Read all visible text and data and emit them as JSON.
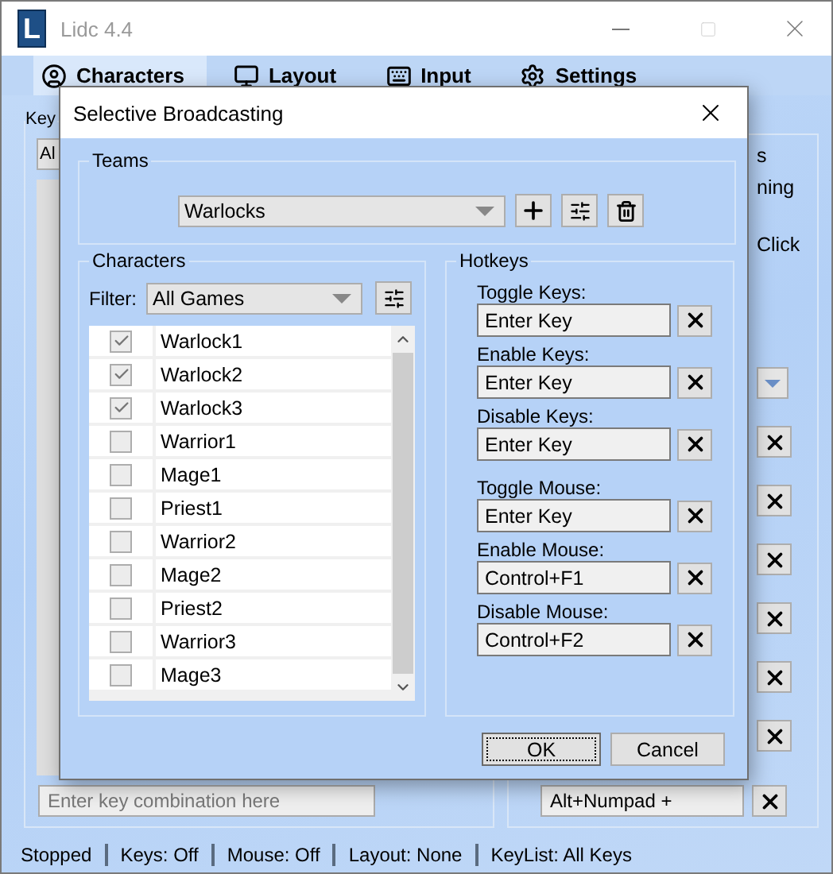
{
  "window": {
    "logo": "L",
    "title": "Lidc 4.4"
  },
  "tabs": [
    {
      "label": "Characters",
      "selected": true
    },
    {
      "label": "Layout",
      "selected": false
    },
    {
      "label": "Input",
      "selected": false
    },
    {
      "label": "Settings",
      "selected": false
    }
  ],
  "background": {
    "left_group_label": "Key",
    "left_dropdown": "Al",
    "right_texts": [
      "s",
      "ning",
      "Click"
    ],
    "key_field": {
      "placeholder": "Enter key combination here"
    },
    "right_field": {
      "value": "Alt+Numpad +"
    }
  },
  "dialog": {
    "title": "Selective Broadcasting",
    "teams": {
      "label": "Teams",
      "value": "Warlocks"
    },
    "characters": {
      "label": "Characters",
      "filter_label": "Filter:",
      "filter_value": "All Games",
      "rows": [
        {
          "name": "Warlock1",
          "checked": true
        },
        {
          "name": "Warlock2",
          "checked": true
        },
        {
          "name": "Warlock3",
          "checked": true
        },
        {
          "name": "Warrior1",
          "checked": false
        },
        {
          "name": "Mage1",
          "checked": false
        },
        {
          "name": "Priest1",
          "checked": false
        },
        {
          "name": "Warrior2",
          "checked": false
        },
        {
          "name": "Mage2",
          "checked": false
        },
        {
          "name": "Priest2",
          "checked": false
        },
        {
          "name": "Warrior3",
          "checked": false
        },
        {
          "name": "Mage3",
          "checked": false
        }
      ]
    },
    "hotkeys": {
      "label": "Hotkeys",
      "groups": [
        [
          {
            "label": "Toggle Keys:",
            "value": "Enter Key"
          },
          {
            "label": "Enable Keys:",
            "value": "Enter Key"
          },
          {
            "label": "Disable Keys:",
            "value": "Enter Key"
          }
        ],
        [
          {
            "label": "Toggle Mouse:",
            "value": "Enter Key"
          },
          {
            "label": "Enable Mouse:",
            "value": "Control+F1"
          },
          {
            "label": "Disable Mouse:",
            "value": "Control+F2"
          }
        ]
      ]
    },
    "buttons": [
      "OK",
      "Cancel"
    ]
  },
  "status_bar": [
    "Stopped",
    "Keys: Off",
    "Mouse: Off",
    "Layout: None",
    "KeyList: All Keys"
  ]
}
